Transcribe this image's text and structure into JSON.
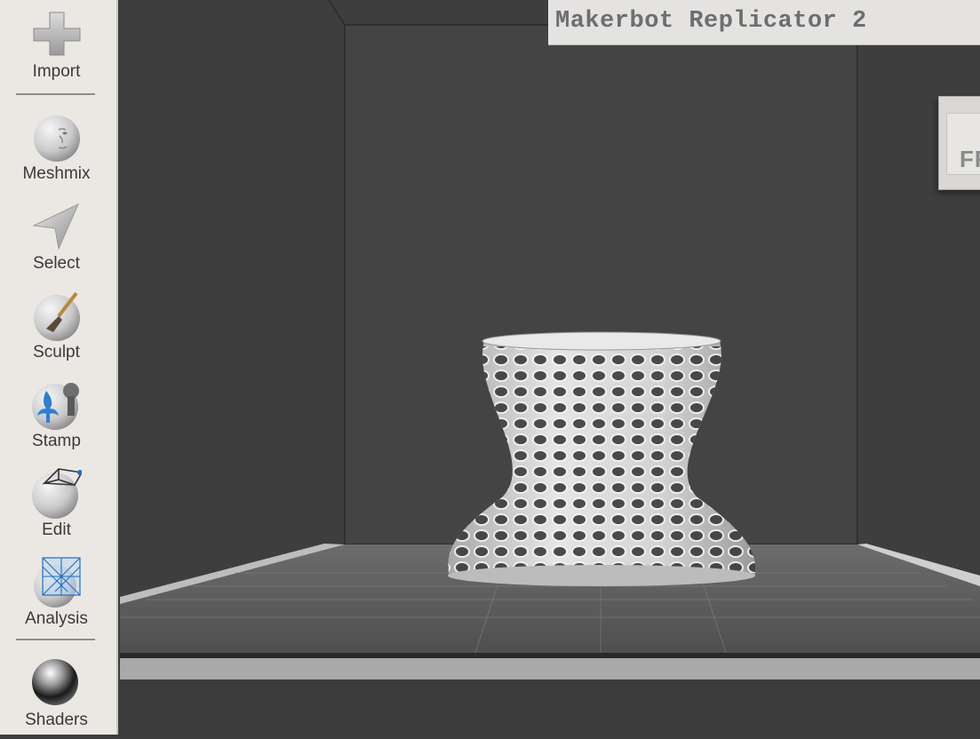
{
  "sidebar": {
    "items": [
      {
        "label": "Import",
        "icon": "plus-icon"
      },
      {
        "label": "Meshmix",
        "icon": "face-sphere-icon"
      },
      {
        "label": "Select",
        "icon": "arrow-pointer-icon"
      },
      {
        "label": "Sculpt",
        "icon": "brush-sphere-icon"
      },
      {
        "label": "Stamp",
        "icon": "fleur-de-lis-stamp-icon"
      },
      {
        "label": "Edit",
        "icon": "wireframe-sphere-icon"
      },
      {
        "label": "Analysis",
        "icon": "mesh-analysis-sphere-icon"
      },
      {
        "label": "Shaders",
        "icon": "chrome-sphere-icon"
      }
    ]
  },
  "viewport": {
    "printer_name": "Makerbot Replicator 2",
    "view_cube_label": "FRO",
    "model": "voronoi-lattice-vase",
    "colors": {
      "background": "#3d3d3d",
      "build_plate": "#5e5e5e",
      "model": "#cfcfcf"
    }
  }
}
